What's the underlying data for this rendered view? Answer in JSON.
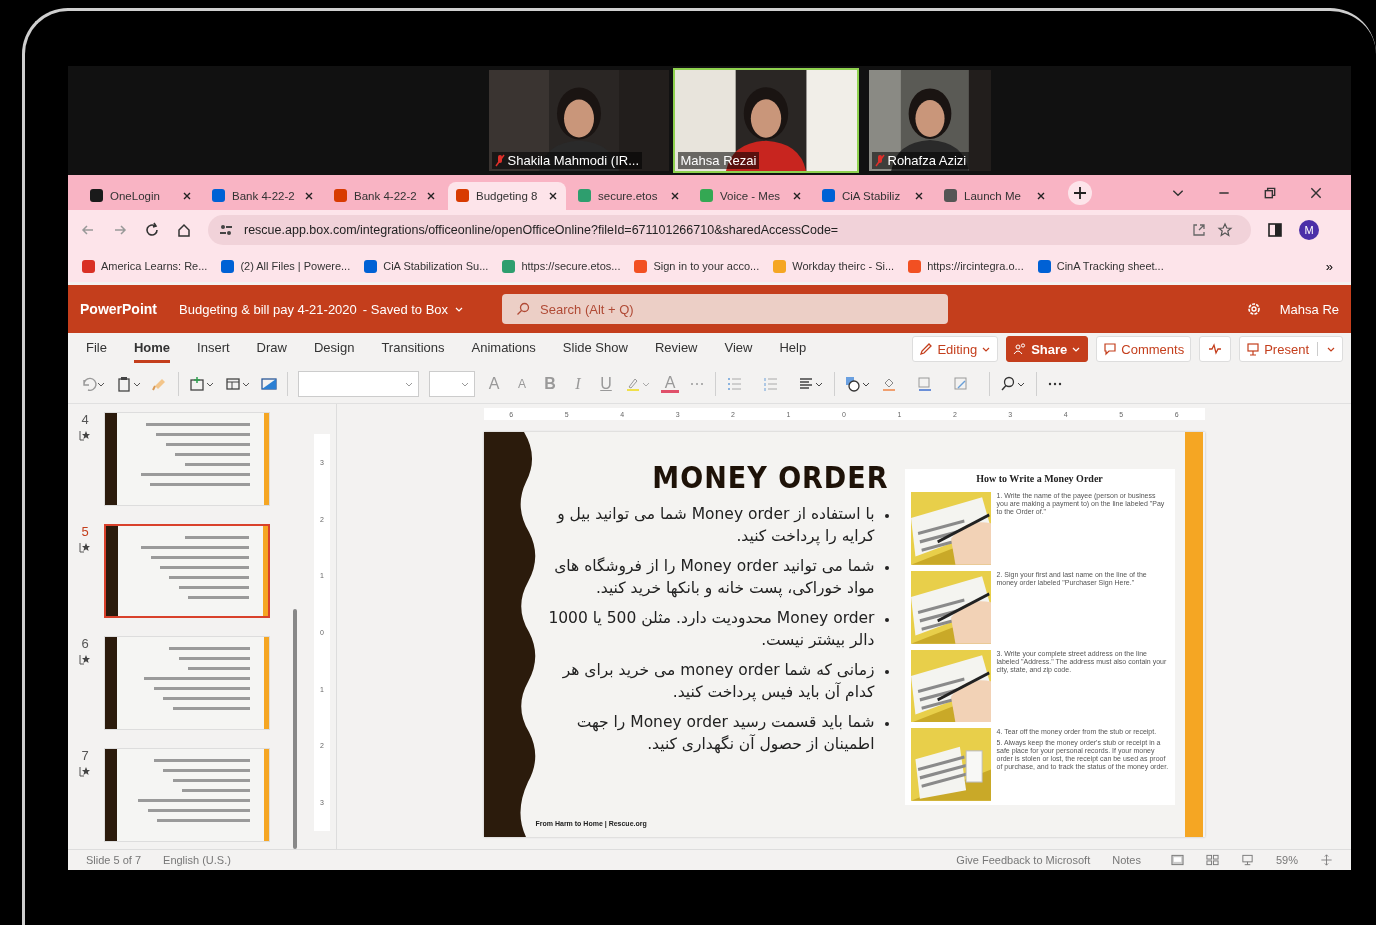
{
  "video": {
    "tiles": [
      {
        "name": "Shakila Mahmodi (IR...",
        "muted": true,
        "active": false
      },
      {
        "name": "Mahsa Rezai",
        "muted": false,
        "active": true
      },
      {
        "name": "Rohafza Azizi",
        "muted": true,
        "active": false
      }
    ]
  },
  "browser": {
    "tabs": [
      {
        "title": "OneLogin",
        "color": "#1a1a1a",
        "selected": false
      },
      {
        "title": "Bank 4-22-2",
        "color": "#0061d5",
        "selected": false
      },
      {
        "title": "Bank 4-22-2",
        "color": "#d83b01",
        "selected": false
      },
      {
        "title": "Budgeting 8",
        "color": "#d83b01",
        "selected": true
      },
      {
        "title": "secure.etos",
        "color": "#2e9e6e",
        "selected": false
      },
      {
        "title": "Voice - Mes",
        "color": "#34a853",
        "selected": false
      },
      {
        "title": "CiA Stabiliz",
        "color": "#0061d5",
        "selected": false
      },
      {
        "title": "Launch Me",
        "color": "#555555",
        "selected": false
      }
    ],
    "url": "rescue.app.box.com/integrations/officeonline/openOfficeOnline?fileId=671101266710&sharedAccessCode=",
    "avatar": "M",
    "bookmarks": [
      {
        "title": "America Learns: Re...",
        "color": "#d93025"
      },
      {
        "title": "(2) All Files | Powere...",
        "color": "#0061d5"
      },
      {
        "title": "CiA Stabilization Su...",
        "color": "#0061d5"
      },
      {
        "title": "https://secure.etos...",
        "color": "#2e9e6e"
      },
      {
        "title": "Sign in to your acco...",
        "color": "#f25022"
      },
      {
        "title": "Workday theirc - Si...",
        "color": "#f5a623"
      },
      {
        "title": "https://ircintegra.o...",
        "color": "#f25022"
      },
      {
        "title": "CinA Tracking sheet...",
        "color": "#0061d5"
      }
    ],
    "more": "»"
  },
  "ppt": {
    "app": "PowerPoint",
    "document": "Budgeting & bill pay 4-21-2020",
    "saved": "- Saved to Box",
    "search_placeholder": "Search (Alt + Q)",
    "user": "Mahsa Re",
    "tabs": [
      {
        "label": "File",
        "selected": false
      },
      {
        "label": "Home",
        "selected": true
      },
      {
        "label": "Insert",
        "selected": false
      },
      {
        "label": "Draw",
        "selected": false
      },
      {
        "label": "Design",
        "selected": false
      },
      {
        "label": "Transitions",
        "selected": false
      },
      {
        "label": "Animations",
        "selected": false
      },
      {
        "label": "Slide Show",
        "selected": false
      },
      {
        "label": "Review",
        "selected": false
      },
      {
        "label": "View",
        "selected": false
      },
      {
        "label": "Help",
        "selected": false
      }
    ],
    "actions": {
      "editing": "Editing",
      "share": "Share",
      "comments": "Comments",
      "present": "Present"
    },
    "toolbar": {
      "grow": "A",
      "shrink": "A",
      "bold": "B",
      "italic": "I",
      "underline": "U",
      "font_color": "A"
    }
  },
  "thumbnails": [
    {
      "number": "4",
      "selected": false
    },
    {
      "number": "5",
      "selected": true
    },
    {
      "number": "6",
      "selected": false
    },
    {
      "number": "7",
      "selected": false
    }
  ],
  "rulers": {
    "horizontal": [
      "6",
      "5",
      "4",
      "3",
      "2",
      "1",
      "0",
      "1",
      "2",
      "3",
      "4",
      "5",
      "6"
    ],
    "vertical": [
      "3",
      "2",
      "1",
      "0",
      "1",
      "2",
      "3"
    ]
  },
  "slide": {
    "title": "MONEY ORDER",
    "bullets": [
      "با استفاده از Money order شما می توانید بیل و کرایه را پرداخت کنید.",
      "شما می توانید Money order  را از فروشگاه های مواد خوراکی، پست خانه و بانکها خرید کنید.",
      "Money order محدودیت دارد. مثلن 500 یا 1000 دالر بیشتر نیست.",
      "زمانی که شما money order  می خرید برای هر کدام آن باید فیس پرداخت کنید.",
      "شما باید قسمت رسید Money order  را جهت اطمینان از حصول آن نگهداری کنید."
    ],
    "footer": "From Harm to Home | Rescue.org",
    "inset": {
      "title": "How to Write a Money Order",
      "steps": [
        [
          "1.  Write the name of the payee (person or business you are making a payment to) on the line labeled \"Pay to the Order of.\""
        ],
        [
          "2.  Sign your first and last name on the line of the money order labeled \"Purchaser Sign Here.\""
        ],
        [
          "3.  Write your complete street address on the line labeled \"Address.\" The address must also contain your city, state, and zip code."
        ],
        [
          "4.  Tear off the money order from the stub or receipt.",
          "5.  Always keep the money order's stub or receipt in a safe place for your personal records. If your money order is stolen or lost, the receipt can be used as proof of purchase, and to track the status of the money order."
        ]
      ]
    }
  },
  "status": {
    "slide": "Slide 5 of 7",
    "language": "English (U.S.)",
    "feedback": "Give Feedback to Microsoft",
    "notes": "Notes",
    "zoom": "59%"
  }
}
